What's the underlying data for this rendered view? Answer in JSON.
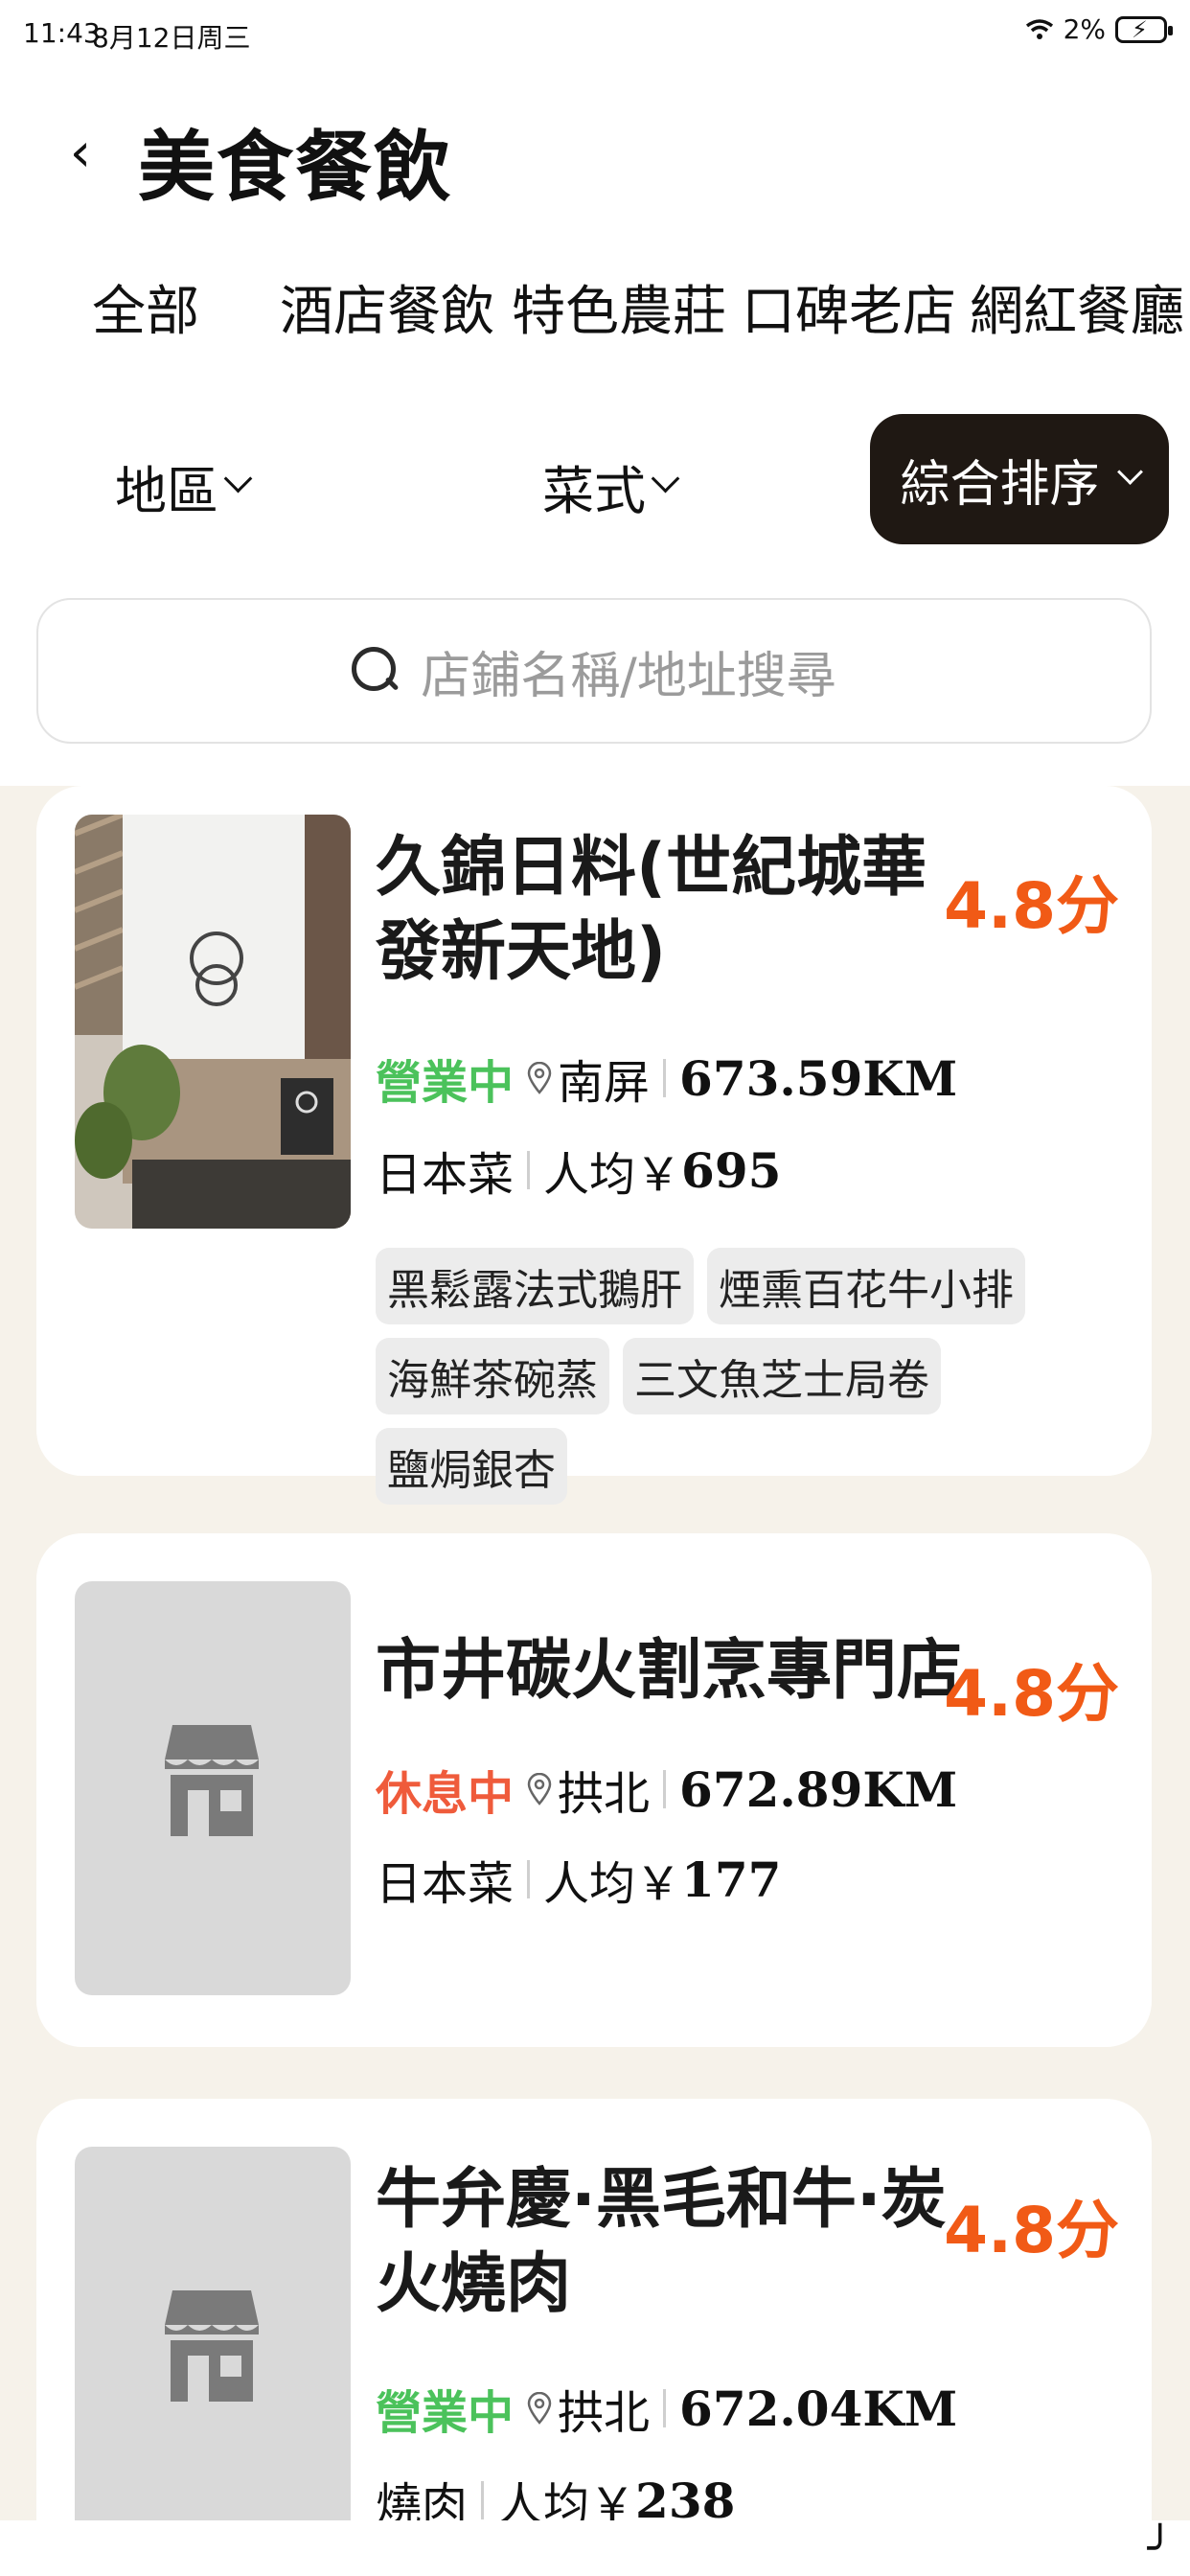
{
  "status_bar": {
    "time": "11:43",
    "date": "8月12日周三",
    "battery": "2%"
  },
  "header": {
    "title": "美食餐飲"
  },
  "tabs": [
    "全部",
    "酒店餐飲",
    "特色農莊",
    "口碑老店",
    "網紅餐廳"
  ],
  "filters": {
    "region": "地區",
    "cuisine": "菜式",
    "sort": "綜合排序"
  },
  "search": {
    "placeholder": "店鋪名稱/地址搜尋"
  },
  "restaurants": [
    {
      "name": "久錦日料(世紀城華發新天地)",
      "rating": "4.8分",
      "status": "營業中",
      "area": "南屏",
      "distance": "673.59KM",
      "cuisine": "日本菜",
      "avg_label": "人均￥",
      "avg_price": "695",
      "tags": [
        "黑鬆露法式鵝肝",
        "煙熏百花牛小排",
        "海鮮茶碗蒸",
        "三文魚芝士局卷",
        "鹽焗銀杏"
      ]
    },
    {
      "name": "市井碳火割烹專門店",
      "rating": "4.8分",
      "status": "休息中",
      "area": "拱北",
      "distance": "672.89KM",
      "cuisine": "日本菜",
      "avg_label": "人均￥",
      "avg_price": "177",
      "tags": []
    },
    {
      "name": "牛弁慶·黑毛和牛·炭火燒肉",
      "rating": "4.8分",
      "status": "營業中",
      "area": "拱北",
      "distance": "672.04KM",
      "cuisine": "燒肉",
      "avg_label": "人均￥",
      "avg_price": "238",
      "tags": []
    }
  ],
  "colors": {
    "accent": "#f15a16",
    "open": "#4bc25b",
    "closed": "#ef5b3b",
    "dark_button": "#1f1813",
    "list_background": "#f6f2ea"
  }
}
